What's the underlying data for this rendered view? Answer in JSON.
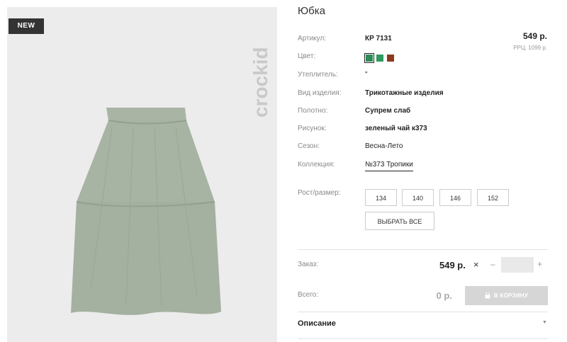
{
  "product": {
    "badge": "NEW",
    "brand": "crockid",
    "title": "Юбка",
    "price": "549 р.",
    "rrp": "РРЦ: 1099 р."
  },
  "details": {
    "article_label": "Артикул:",
    "article_value": "КР 7131",
    "color_label": "Цвет:",
    "insulation_label": "Утеплитель:",
    "insulation_value": "\"",
    "type_label": "Вид изделия:",
    "type_value": "Трикотажные изделия",
    "fabric_label": "Полотно:",
    "fabric_value": "Супрем слаб",
    "pattern_label": "Рисунок:",
    "pattern_value": "зеленый чай к373",
    "season_label": "Сезон:",
    "season_value": "Весна-Лето",
    "collection_label": "Коллекция:",
    "collection_value": "№373 Тропики"
  },
  "colors": [
    "#2e8b57",
    "#2e9a5c",
    "#8b3a20"
  ],
  "sizes": {
    "label": "Рост/размер:",
    "options": [
      "134",
      "140",
      "146",
      "152"
    ],
    "select_all": "ВЫБРАТЬ ВСЕ"
  },
  "order": {
    "label": "Заказ:",
    "price": "549 р.",
    "multiply": "×",
    "minus": "–",
    "quantity": "",
    "plus": "+",
    "total_label": "Всего:",
    "total_value": "0 р.",
    "cart_button": "В КОРЗИНУ"
  },
  "description": {
    "label": "Описание",
    "caret": "▼"
  }
}
